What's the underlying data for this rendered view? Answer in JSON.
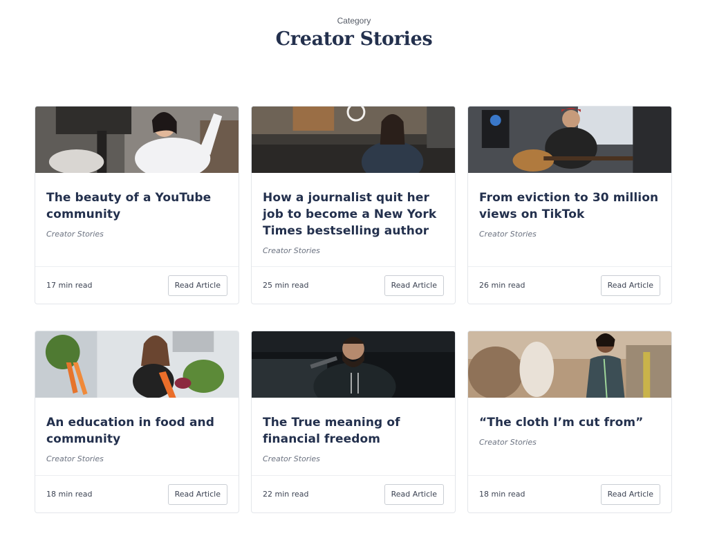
{
  "header": {
    "eyebrow": "Category",
    "title": "Creator Stories"
  },
  "cards": [
    {
      "title": "The beauty of a YouTube community",
      "category": "Creator Stories",
      "read_time": "17 min read",
      "button": "Read Article",
      "image": "woman-waving-at-camera-photo"
    },
    {
      "title": "How a journalist quit her job to become a New York Times bestselling author",
      "category": "Creator Stories",
      "read_time": "25 min read",
      "button": "Read Article",
      "image": "woman-at-desk-with-ring-light-photo"
    },
    {
      "title": "From eviction to 30 million views on TikTok",
      "category": "Creator Stories",
      "read_time": "26 min read",
      "button": "Read Article",
      "image": "man-playing-guitar-in-studio-photo"
    },
    {
      "title": "An education in food and community",
      "category": "Creator Stories",
      "read_time": "18 min read",
      "button": "Read Article",
      "image": "woman-holding-vegetables-photo"
    },
    {
      "title": "The True meaning of financial freedom",
      "category": "Creator Stories",
      "read_time": "22 min read",
      "button": "Read Article",
      "image": "bearded-man-at-microphone-photo"
    },
    {
      "title": "“The cloth I’m cut from”",
      "category": "Creator Stories",
      "read_time": "18 min read",
      "button": "Read Article",
      "image": "woman-in-clothing-store-photo"
    }
  ]
}
